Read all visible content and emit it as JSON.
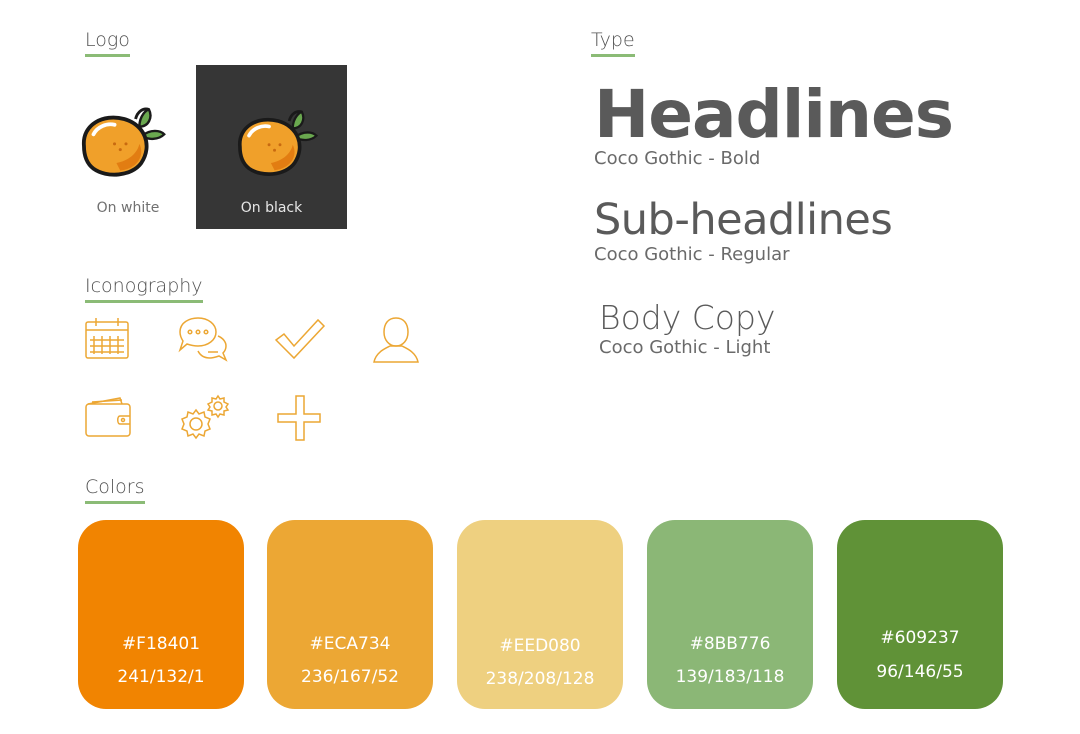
{
  "sections": {
    "logo": "Logo",
    "type": "Type",
    "iconography": "Iconography",
    "colors": "Colors"
  },
  "logo": {
    "on_white": "On white",
    "on_black": "On black"
  },
  "icons": [
    "calendar-icon",
    "chat-bubbles-icon",
    "checkmark-icon",
    "user-icon",
    "wallet-icon",
    "gears-icon",
    "plus-icon"
  ],
  "type": {
    "headline": {
      "sample": "Headlines",
      "font": "Coco Gothic - Bold"
    },
    "subheadline": {
      "sample": "Sub-headlines",
      "font": "Coco Gothic - Regular"
    },
    "body": {
      "sample": "Body Copy",
      "font": "Coco Gothic - Light"
    }
  },
  "colors": [
    {
      "hex": "#F18401",
      "rgb": "241/132/1",
      "value": "#F18401"
    },
    {
      "hex": "#ECA734",
      "rgb": "236/167/52",
      "value": "#ECA734"
    },
    {
      "hex": "#EED080",
      "rgb": "238/208/128",
      "value": "#EED080"
    },
    {
      "hex": "#8BB776",
      "rgb": "139/183/118",
      "value": "#8BB776"
    },
    {
      "hex": "#609237",
      "rgb": "96/146/55",
      "value": "#609237"
    }
  ],
  "accent_color": "#8bbb76",
  "icon_color": "#ECA734"
}
